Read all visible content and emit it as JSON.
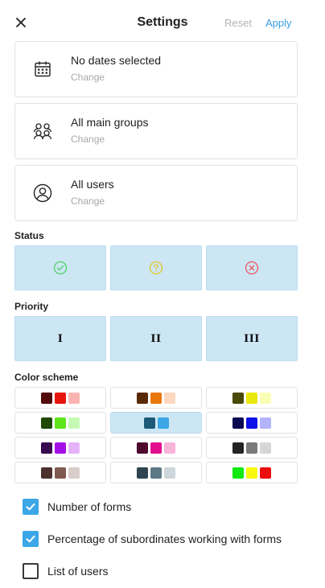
{
  "header": {
    "title": "Settings",
    "reset_label": "Reset",
    "apply_label": "Apply"
  },
  "filters": [
    {
      "main": "No dates selected",
      "sub": "Change",
      "icon": "calendar-icon"
    },
    {
      "main": "All main groups",
      "sub": "Change",
      "icon": "group-icon"
    },
    {
      "main": "All users",
      "sub": "Change",
      "icon": "user-icon"
    }
  ],
  "status": {
    "label": "Status",
    "options": [
      {
        "icon": "check-circle-icon",
        "color": "#4cd263"
      },
      {
        "icon": "question-circle-icon",
        "color": "#e8c22a"
      },
      {
        "icon": "cross-circle-icon",
        "color": "#f0545f"
      }
    ]
  },
  "priority": {
    "label": "Priority",
    "options": [
      "I",
      "II",
      "III"
    ]
  },
  "color_scheme": {
    "label": "Color scheme",
    "selected_index": 4,
    "schemes": [
      [
        "#520a0a",
        "#e8150f",
        "#f9b4b2"
      ],
      [
        "#5a2a06",
        "#ea770c",
        "#fcd8bf"
      ],
      [
        "#4a4a0a",
        "#e8e80e",
        "#fafdb4"
      ],
      [
        "#1e4a06",
        "#5ee61a",
        "#c6fab4"
      ],
      [
        "#1c5a78",
        "#3ba7e6"
      ],
      [
        "#0a0a52",
        "#0e10e8",
        "#b4b4fb"
      ],
      [
        "#3a0a4e",
        "#a40ee6",
        "#e5b4f8"
      ],
      [
        "#4e0a2e",
        "#e20e8e",
        "#f9b4da"
      ],
      [
        "#232323",
        "#7a7a7a",
        "#d6d6d6"
      ],
      [
        "#4c302c",
        "#7f5a50",
        "#d8cdc8"
      ],
      [
        "#2e4450",
        "#5d7985",
        "#cdd6da"
      ],
      [
        "#12ea12",
        "#f9f90e",
        "#ec0d0d"
      ]
    ]
  },
  "options": [
    {
      "label": "Number of forms",
      "checked": true
    },
    {
      "label": "Percentage of subordinates working with forms",
      "checked": true
    },
    {
      "label": "List of users",
      "checked": false
    }
  ]
}
